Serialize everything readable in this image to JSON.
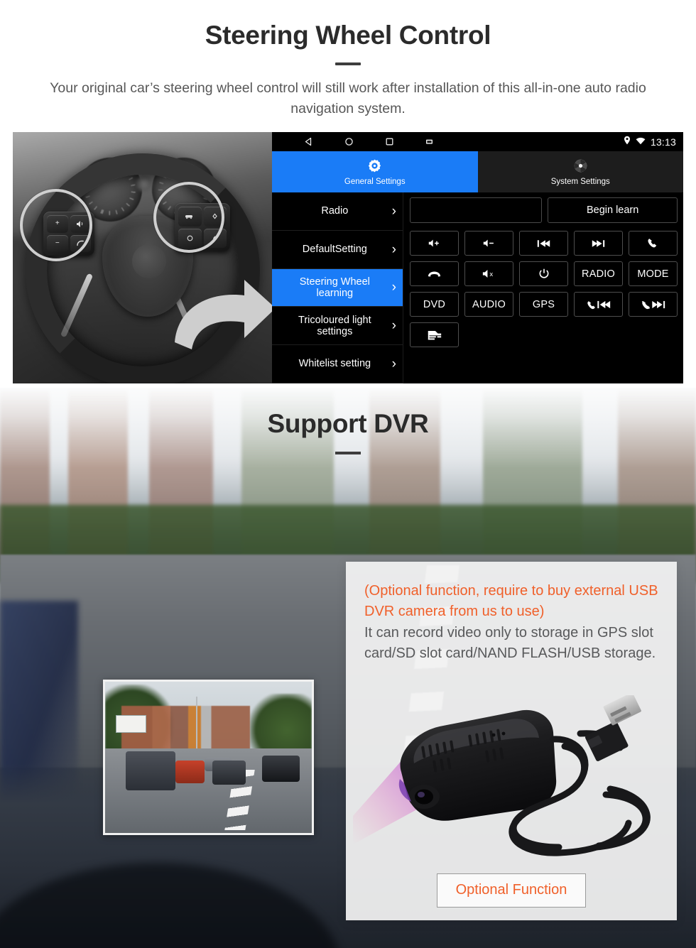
{
  "section1": {
    "title": "Steering Wheel Control",
    "subtitle": "Your original car’s steering wheel control will still work after installation of this all-in-one auto radio navigation system.",
    "android": {
      "statusbar": {
        "clock": "13:13",
        "nav_back": "back-triangle-icon",
        "nav_home": "home-circle-icon",
        "nav_recents": "recents-square-icon",
        "nav_screenshot": "screenshot-icon",
        "location_icon": "location-pin-icon",
        "wifi_icon": "wifi-icon"
      },
      "tabs": [
        {
          "label": "General Settings",
          "icon": "gear-icon",
          "active": true,
          "accent": "#1a7cf7"
        },
        {
          "label": "System Settings",
          "icon": "aperture-icon",
          "active": false
        }
      ],
      "menu": [
        {
          "label": "Radio",
          "selected": false
        },
        {
          "label": "DefaultSetting",
          "selected": false
        },
        {
          "label": "Steering Wheel learning",
          "selected": true
        },
        {
          "label": "Tricoloured light settings",
          "selected": false
        },
        {
          "label": "Whitelist setting",
          "selected": false
        }
      ],
      "pane": {
        "input_value": "",
        "begin_learn_label": "Begin learn",
        "buttons": [
          {
            "label": "",
            "icon": "volume-up-icon"
          },
          {
            "label": "",
            "icon": "volume-down-icon"
          },
          {
            "label": "",
            "icon": "previous-track-icon"
          },
          {
            "label": "",
            "icon": "next-track-icon"
          },
          {
            "label": "",
            "icon": "call-answer-icon"
          },
          {
            "label": "",
            "icon": "call-hangup-icon"
          },
          {
            "label": "",
            "icon": "volume-mute-icon"
          },
          {
            "label": "",
            "icon": "power-icon"
          },
          {
            "label": "RADIO",
            "icon": ""
          },
          {
            "label": "MODE",
            "icon": ""
          },
          {
            "label": "DVD",
            "icon": ""
          },
          {
            "label": "AUDIO",
            "icon": ""
          },
          {
            "label": "GPS",
            "icon": ""
          },
          {
            "label": "",
            "icon": "call-previous-icon"
          },
          {
            "label": "",
            "icon": "call-reject-next-icon"
          },
          {
            "label": "",
            "icon": "car-icon"
          }
        ]
      }
    }
  },
  "section2": {
    "title": "Support DVR",
    "card": {
      "orange_text": "(Optional function, require to buy external USB DVR camera from us to use)",
      "grey_text": "It can record video only to storage in GPS slot card/SD slot card/NAND FLASH/USB storage.",
      "button_label": "Optional Function"
    },
    "preview_label": "dvr-road-preview"
  },
  "colors": {
    "accent_blue": "#1a7cf7",
    "accent_orange": "#f0602a",
    "highlight_yellow": "#FFD21E",
    "heading": "#2b2b2b",
    "body_text": "#575757"
  }
}
